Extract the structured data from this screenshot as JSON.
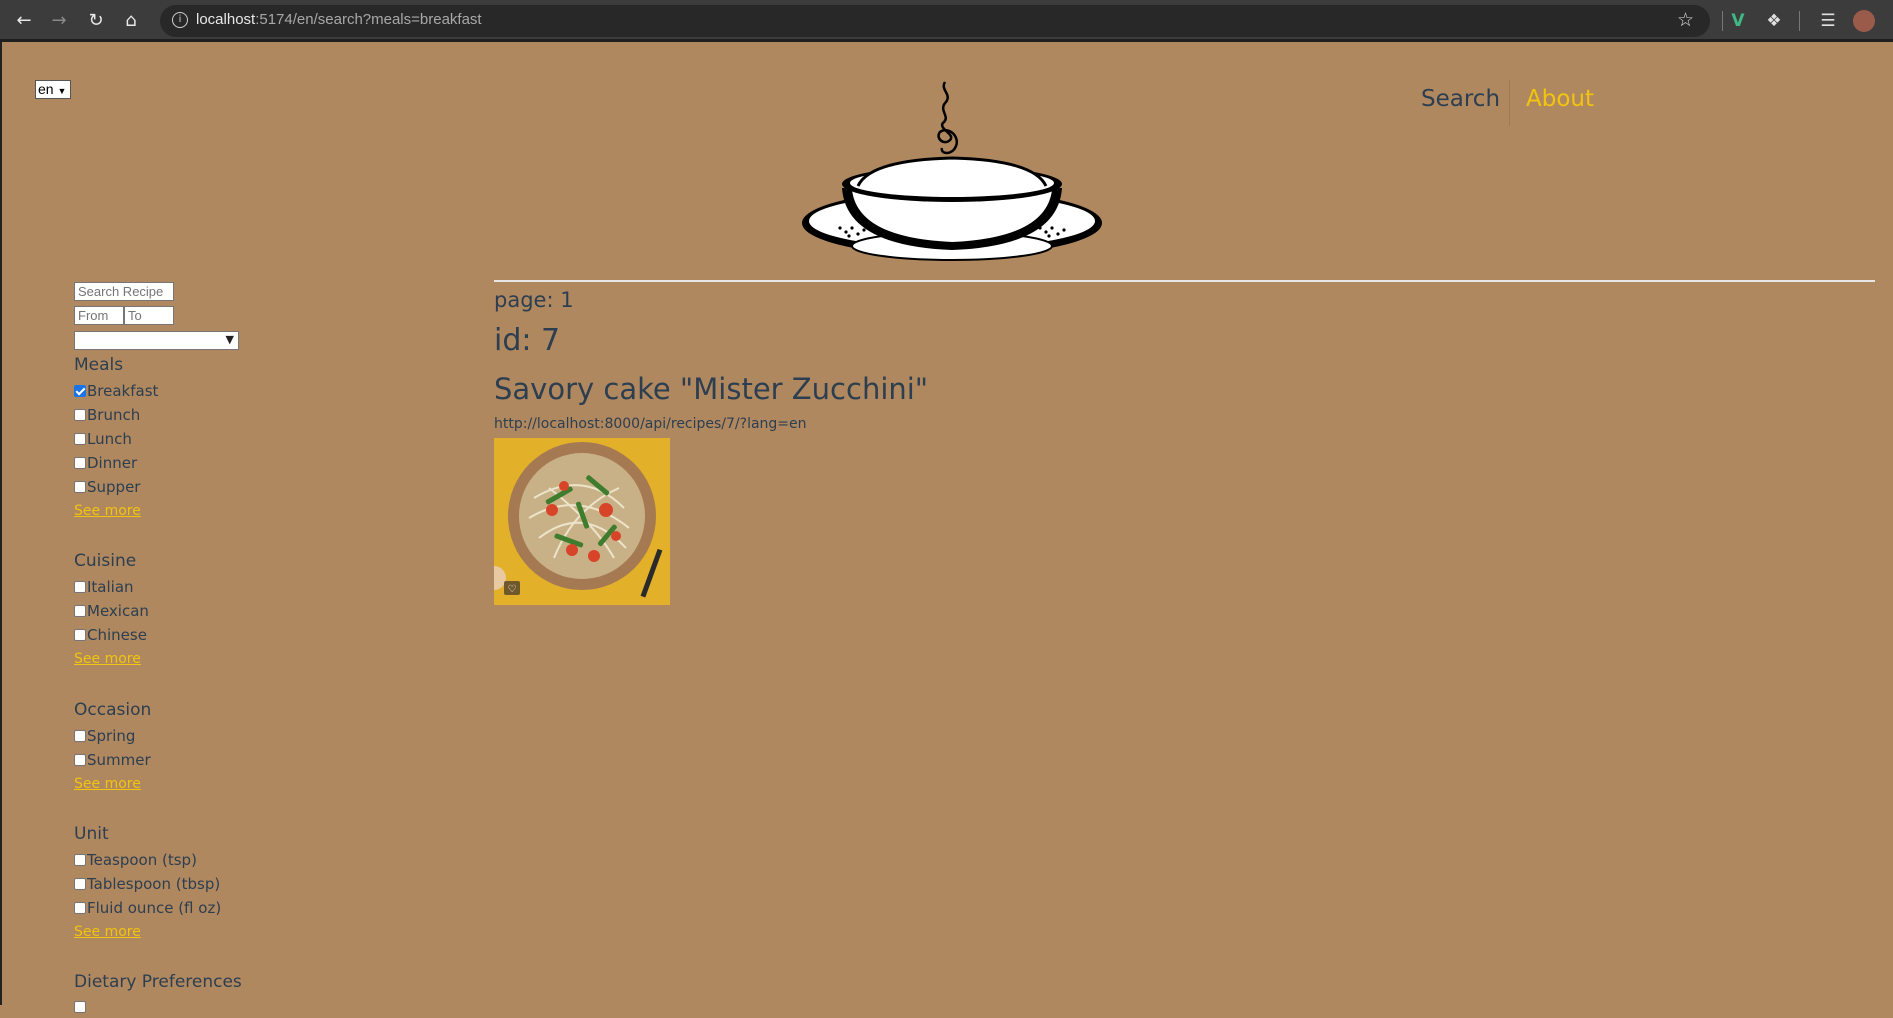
{
  "browser": {
    "url_host": "localhost",
    "url_rest": ":5174/en/search?meals=breakfast",
    "icons": [
      "back-icon",
      "forward-icon",
      "reload-icon",
      "home-icon",
      "info-icon",
      "star-icon",
      "vue-devtools-icon",
      "extensions-icon",
      "media-icon",
      "profile-avatar"
    ]
  },
  "lang": {
    "selected": "en"
  },
  "nav": {
    "search": "Search",
    "about": "About"
  },
  "colors": {
    "background": "#b0885f",
    "accent": "#f1c40f",
    "text": "#2c3e50"
  },
  "sidebar": {
    "search_placeholder": "Search Recipe",
    "from_placeholder": "From",
    "to_placeholder": "To",
    "sort_value": "",
    "groups": [
      {
        "title": "Meals",
        "items": [
          {
            "label": "Breakfast",
            "checked": true
          },
          {
            "label": "Brunch",
            "checked": false
          },
          {
            "label": "Lunch",
            "checked": false
          },
          {
            "label": "Dinner",
            "checked": false
          },
          {
            "label": "Supper",
            "checked": false
          }
        ],
        "see_more": "See more"
      },
      {
        "title": "Cuisine",
        "items": [
          {
            "label": "Italian",
            "checked": false
          },
          {
            "label": "Mexican",
            "checked": false
          },
          {
            "label": "Chinese",
            "checked": false
          }
        ],
        "see_more": "See more"
      },
      {
        "title": "Occasion",
        "items": [
          {
            "label": "Spring",
            "checked": false
          },
          {
            "label": "Summer",
            "checked": false
          }
        ],
        "see_more": "See more"
      },
      {
        "title": "Unit",
        "items": [
          {
            "label": "Teaspoon (tsp)",
            "checked": false
          },
          {
            "label": "Tablespoon (tbsp)",
            "checked": false
          },
          {
            "label": "Fluid ounce (fl oz)",
            "checked": false
          }
        ],
        "see_more": "See more"
      },
      {
        "title": "Dietary Preferences",
        "items": []
      }
    ]
  },
  "main": {
    "page": "page: 1",
    "id": "id: 7",
    "title": "Savory cake \"Mister Zucchini\"",
    "api_url": "http://localhost:8000/api/recipes/7/?lang=en"
  }
}
